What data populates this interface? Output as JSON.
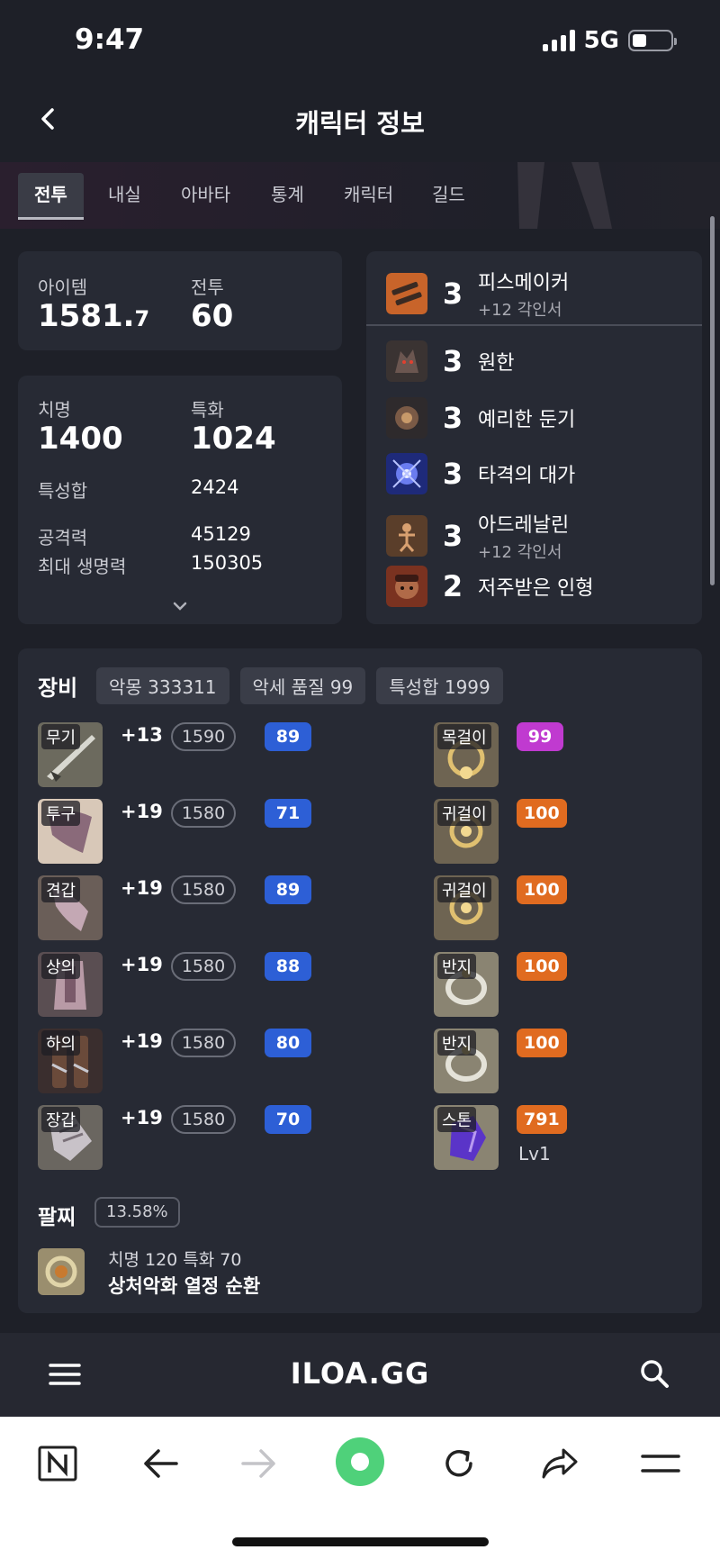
{
  "status_bar": {
    "time": "9:47",
    "network": "5G"
  },
  "header": {
    "title": "캐릭터 정보"
  },
  "tabs": [
    {
      "label": "전투",
      "active": true
    },
    {
      "label": "내실"
    },
    {
      "label": "아바타"
    },
    {
      "label": "통계"
    },
    {
      "label": "캐릭터"
    },
    {
      "label": "길드"
    }
  ],
  "summary": {
    "item_label": "아이템",
    "item_main": "1581.",
    "item_decimal": "7",
    "combat_label": "전투",
    "combat_value": "60"
  },
  "stats": {
    "crit_label": "치명",
    "crit_value": "1400",
    "spec_label": "특화",
    "spec_value": "1024",
    "sum_label": "특성합",
    "sum_value": "2424",
    "atk_label": "공격력",
    "atk_value": "45129",
    "hp_label": "최대 생명력",
    "hp_value": "150305"
  },
  "engravings": [
    {
      "level": "3",
      "name": "피스메이커",
      "sub": "+12 각인서",
      "icon_color": "#c8642a"
    },
    {
      "level": "3",
      "name": "원한",
      "sub": "",
      "icon_color": "#4a3b3a"
    },
    {
      "level": "3",
      "name": "예리한 둔기",
      "sub": "",
      "icon_color": "#5a4036"
    },
    {
      "level": "3",
      "name": "타격의 대가",
      "sub": "",
      "icon_color": "#3a46c8"
    },
    {
      "level": "3",
      "name": "아드레날린",
      "sub": "+12 각인서",
      "icon_color": "#6a4a30"
    },
    {
      "level": "2",
      "name": "저주받은 인형",
      "sub": "",
      "icon_color": "#8a3b22"
    }
  ],
  "equipment": {
    "title": "장비",
    "badges": [
      "악몽 333311",
      "악세 품질 99",
      "특성합 1999"
    ],
    "gear": [
      {
        "slot": "무기",
        "enhance": "+13",
        "ilvl": "1590",
        "quality": "89"
      },
      {
        "slot": "투구",
        "enhance": "+19",
        "ilvl": "1580",
        "quality": "71"
      },
      {
        "slot": "견갑",
        "enhance": "+19",
        "ilvl": "1580",
        "quality": "89"
      },
      {
        "slot": "상의",
        "enhance": "+19",
        "ilvl": "1580",
        "quality": "88"
      },
      {
        "slot": "하의",
        "enhance": "+19",
        "ilvl": "1580",
        "quality": "80"
      },
      {
        "slot": "장갑",
        "enhance": "+19",
        "ilvl": "1580",
        "quality": "70"
      }
    ],
    "accessories": [
      {
        "slot": "목걸이",
        "quality": "99",
        "grade": "purple"
      },
      {
        "slot": "귀걸이",
        "quality": "100",
        "grade": "orange"
      },
      {
        "slot": "귀걸이",
        "quality": "100",
        "grade": "orange"
      },
      {
        "slot": "반지",
        "quality": "100",
        "grade": "orange"
      },
      {
        "slot": "반지",
        "quality": "100",
        "grade": "orange"
      },
      {
        "slot": "스톤",
        "quality": "791",
        "grade": "orange",
        "level": "Lv1"
      }
    ]
  },
  "bracelet": {
    "title": "팔찌",
    "percent": "13.58%",
    "stats_line": "치명 120  특화 70",
    "effects_line": "상처악화  열정  순환"
  },
  "site_nav": {
    "brand": "ILOA.GG"
  },
  "colors": {
    "background": "#1e2028",
    "card": "#272a34",
    "quality_blue": "#2d5fd6",
    "quality_purple": "#c03ad0",
    "quality_orange": "#e06b20",
    "progress_green": "#4fd17a"
  },
  "icons": [
    "back-arrow-icon",
    "signal-icon",
    "battery-icon",
    "chevron-down-icon",
    "menu-icon",
    "search-icon",
    "naver-icon",
    "browser-back-icon",
    "browser-forward-icon",
    "green-dot-icon",
    "reload-icon",
    "share-icon",
    "browser-menu-icon"
  ]
}
